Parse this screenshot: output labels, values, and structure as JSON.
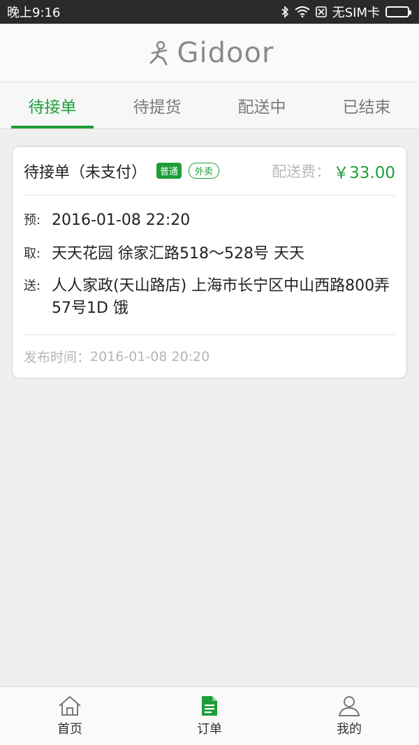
{
  "status_bar": {
    "time": "晚上9:16",
    "carrier": "无SIM卡"
  },
  "header": {
    "logo_text": "Gidoor"
  },
  "tabs": [
    {
      "label": "待接单",
      "active": true
    },
    {
      "label": "待提货",
      "active": false
    },
    {
      "label": "配送中",
      "active": false
    },
    {
      "label": "已结束",
      "active": false
    }
  ],
  "order": {
    "status": "待接单（未支付）",
    "badge_type": "普通",
    "badge_category": "外卖",
    "fee_label": "配送费：",
    "fee_value": "￥33.00",
    "scheduled_label": "预:",
    "scheduled_value": "2016-01-08 22:20",
    "pickup_label": "取:",
    "pickup_value": "天天花园 徐家汇路518～528号 天天",
    "delivery_label": "送:",
    "delivery_value": "人人家政(天山路店) 上海市长宁区中山西路800弄57号1D 饿",
    "publish_label": "发布时间：",
    "publish_value": "2016-01-08 20:20"
  },
  "bottom_nav": [
    {
      "label": "首页",
      "icon": "home-icon"
    },
    {
      "label": "订单",
      "icon": "document-icon"
    },
    {
      "label": "我的",
      "icon": "user-icon"
    }
  ],
  "colors": {
    "accent": "#1e9e3a",
    "status_bar": "#2a2a2a"
  }
}
